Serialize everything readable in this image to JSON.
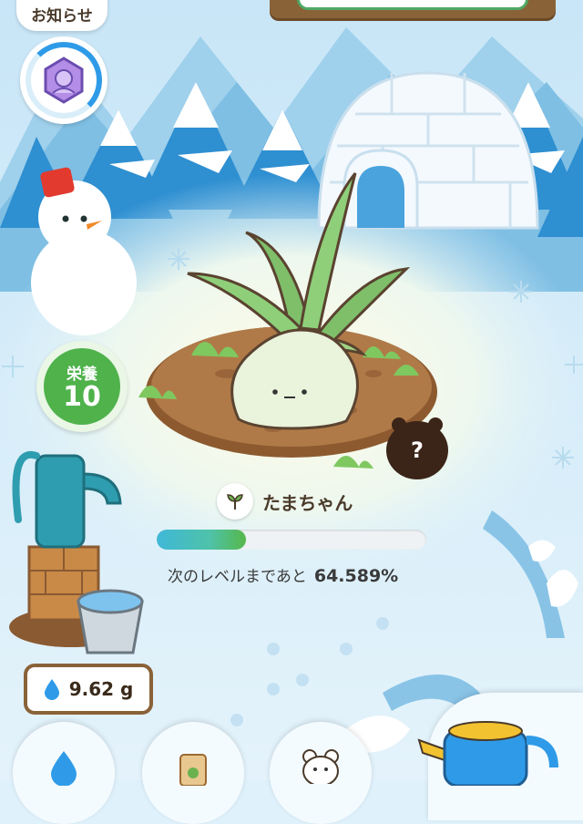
{
  "notice": {
    "label": "お知らせ"
  },
  "nutrition": {
    "label": "栄養",
    "value": "10"
  },
  "plant": {
    "name": "たまちゃん"
  },
  "level": {
    "next_label": "次のレベルまであと",
    "progress_text": "64.589%",
    "bar_fill": 0.33
  },
  "water": {
    "amount": "9.62 g"
  },
  "unknown_creature": {
    "symbol": "?"
  },
  "colors": {
    "accent_green": "#4fb24b",
    "sky_blue": "#2f9be8",
    "wood": "#8a6238"
  }
}
